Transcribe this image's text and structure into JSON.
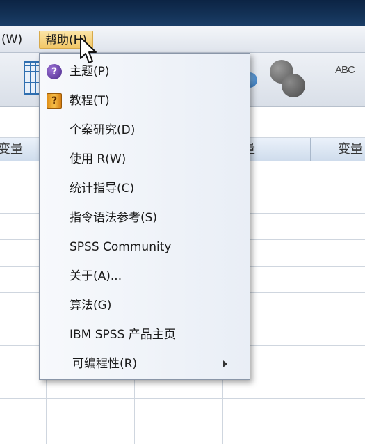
{
  "menubar": {
    "window_label": "(W)",
    "help_label": "帮助",
    "help_accel": "(H)"
  },
  "toolbar": {
    "spell_label": "ABC"
  },
  "grid": {
    "columns": [
      "变量",
      "变量",
      "变量"
    ]
  },
  "help_menu": {
    "items": [
      {
        "text": "主题",
        "accel": "(P)",
        "icon": "help-circle-icon"
      },
      {
        "text": "教程",
        "accel": "(T)",
        "icon": "tutorial-book-icon"
      },
      {
        "text": "个案研究",
        "accel": "(D)"
      },
      {
        "text": "使用 R",
        "accel": "(W)"
      },
      {
        "text": "统计指导",
        "accel": "(C)"
      },
      {
        "text": "指令语法参考",
        "accel": "(S)"
      },
      {
        "text": "SPSS Community",
        "accel": ""
      },
      {
        "text": "关于",
        "accel": "(A)..."
      },
      {
        "text": "算法",
        "accel": "(G)"
      },
      {
        "text": "IBM SPSS 产品主页",
        "accel": ""
      },
      {
        "text": "可编程性",
        "accel": "(R)",
        "submenu": true
      }
    ]
  },
  "colors": {
    "title_bar": "#143358",
    "menu_highlight": "#f2c766",
    "help_icon": "#4b2a8a",
    "tutorial_icon": "#e0901a"
  }
}
